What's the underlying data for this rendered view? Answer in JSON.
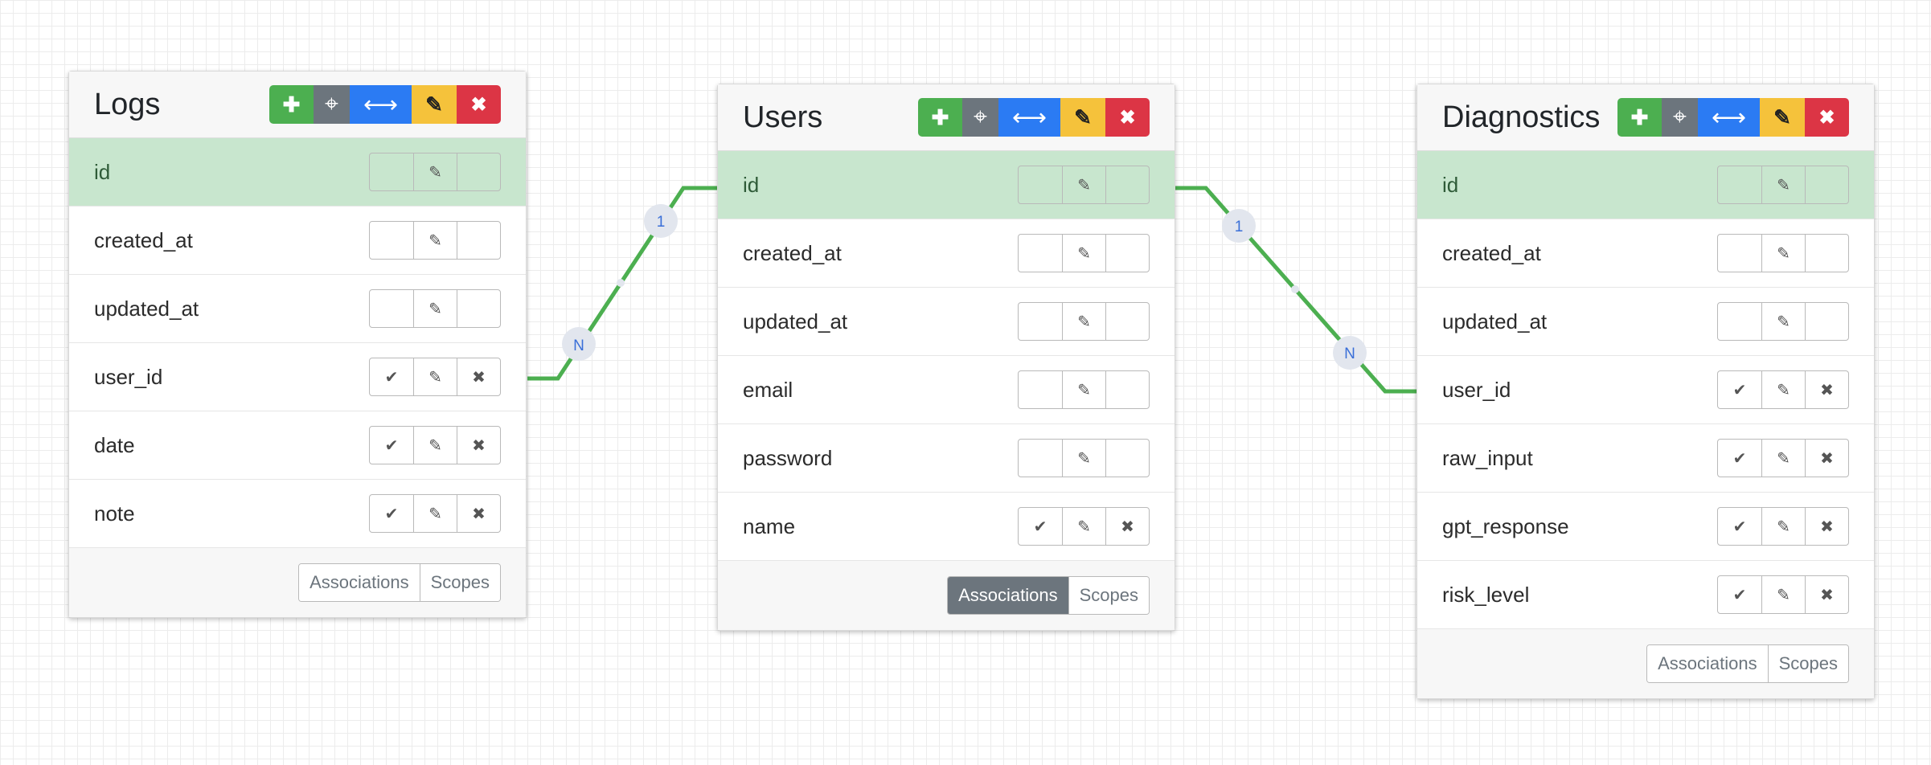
{
  "icons": {
    "add": "✚",
    "move": "⌖",
    "widen": "⟷",
    "edit": "✎",
    "delete": "✖",
    "check": "✔",
    "pencil": "✎",
    "cross": "✖"
  },
  "colors": {
    "relation_line": "#4caf50",
    "badge_fill": "#e2e6ee",
    "badge_text": "#3a6fd8",
    "primary_row": "#c8e6ce"
  },
  "tables": [
    {
      "title": "Logs",
      "fields": [
        {
          "name": "id",
          "primary": true,
          "actions": [
            "",
            "edit",
            ""
          ]
        },
        {
          "name": "created_at",
          "actions": [
            "",
            "edit",
            ""
          ]
        },
        {
          "name": "updated_at",
          "actions": [
            "",
            "edit",
            ""
          ]
        },
        {
          "name": "user_id",
          "actions": [
            "check",
            "edit",
            "cross"
          ]
        },
        {
          "name": "date",
          "actions": [
            "check",
            "edit",
            "cross"
          ]
        },
        {
          "name": "note",
          "actions": [
            "check",
            "edit",
            "cross"
          ]
        }
      ],
      "footer": {
        "associations": "Associations",
        "scopes": "Scopes",
        "active": "none"
      }
    },
    {
      "title": "Users",
      "fields": [
        {
          "name": "id",
          "primary": true,
          "actions": [
            "",
            "edit",
            ""
          ]
        },
        {
          "name": "created_at",
          "actions": [
            "",
            "edit",
            ""
          ]
        },
        {
          "name": "updated_at",
          "actions": [
            "",
            "edit",
            ""
          ]
        },
        {
          "name": "email",
          "actions": [
            "",
            "edit",
            ""
          ]
        },
        {
          "name": "password",
          "actions": [
            "",
            "edit",
            ""
          ]
        },
        {
          "name": "name",
          "actions": [
            "check",
            "edit",
            "cross"
          ]
        }
      ],
      "footer": {
        "associations": "Associations",
        "scopes": "Scopes",
        "active": "associations"
      }
    },
    {
      "title": "Diagnostics",
      "fields": [
        {
          "name": "id",
          "primary": true,
          "actions": [
            "",
            "edit",
            ""
          ]
        },
        {
          "name": "created_at",
          "actions": [
            "",
            "edit",
            ""
          ]
        },
        {
          "name": "updated_at",
          "actions": [
            "",
            "edit",
            ""
          ]
        },
        {
          "name": "user_id",
          "actions": [
            "check",
            "edit",
            "cross"
          ]
        },
        {
          "name": "raw_input",
          "actions": [
            "check",
            "edit",
            "cross"
          ]
        },
        {
          "name": "gpt_response",
          "actions": [
            "check",
            "edit",
            "cross"
          ]
        },
        {
          "name": "risk_level",
          "actions": [
            "check",
            "edit",
            "cross"
          ]
        }
      ],
      "footer": {
        "associations": "Associations",
        "scopes": "Scopes",
        "active": "none"
      }
    }
  ],
  "relations": [
    {
      "from": "Logs.user_id",
      "to": "Users.id",
      "from_label": "N",
      "to_label": "1"
    },
    {
      "from": "Diagnostics.user_id",
      "to": "Users.id",
      "from_label": "N",
      "to_label": "1"
    }
  ]
}
